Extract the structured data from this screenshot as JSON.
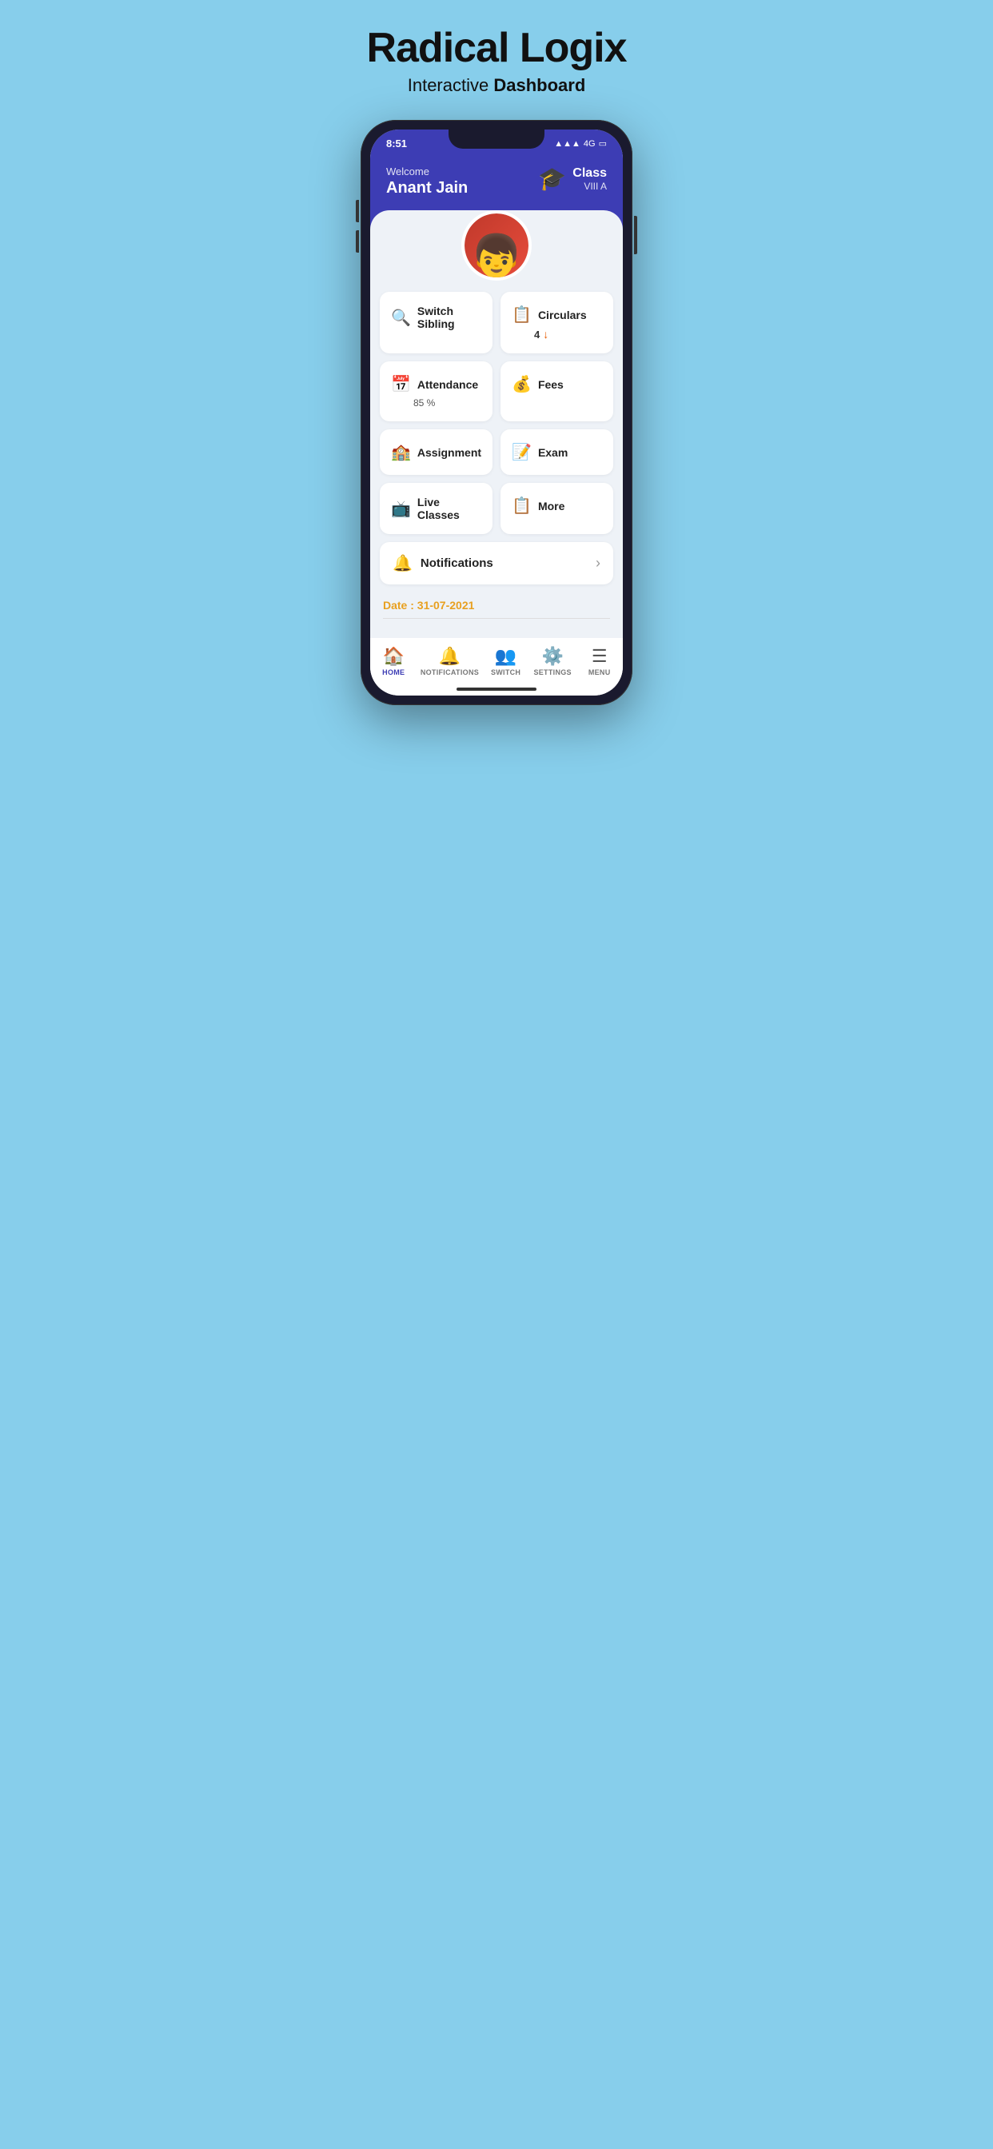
{
  "header": {
    "app_title": "Radical Logix",
    "app_subtitle_normal": "Interactive ",
    "app_subtitle_bold": "Dashboard"
  },
  "status_bar": {
    "time": "8:51",
    "signal": "4G",
    "battery": "🔋"
  },
  "welcome": {
    "label": "Welcome",
    "name": "Anant  Jain"
  },
  "class_info": {
    "label": "Class",
    "value": "VIII A"
  },
  "grid_items": [
    {
      "id": "switch-sibling",
      "icon": "🔍",
      "label": "Switch Sibling",
      "sub": null
    },
    {
      "id": "circulars",
      "icon": "📋",
      "label": "Circulars",
      "sub": "4",
      "has_arrow": true
    },
    {
      "id": "attendance",
      "icon": "📅",
      "label": "Attendance",
      "sub": "85 %"
    },
    {
      "id": "fees",
      "icon": "💰",
      "label": "Fees",
      "sub": null
    },
    {
      "id": "assignment",
      "icon": "🏫",
      "label": "Assignment",
      "sub": null
    },
    {
      "id": "exam",
      "icon": "📝",
      "label": "Exam",
      "sub": null
    },
    {
      "id": "live-classes",
      "icon": "📺",
      "label": "Live Classes",
      "sub": null
    },
    {
      "id": "more",
      "icon": "📋",
      "label": "More",
      "sub": null
    }
  ],
  "notifications": {
    "label": "Notifications",
    "icon": "🔔"
  },
  "date": {
    "text": "Date : 31-07-2021"
  },
  "bottom_nav": [
    {
      "id": "home",
      "icon": "🏠",
      "label": "HOME",
      "active": true
    },
    {
      "id": "notifications",
      "icon": "🔔",
      "label": "NOTIFICATIONS",
      "active": false
    },
    {
      "id": "switch",
      "icon": "👥",
      "label": "SWITCH",
      "active": false
    },
    {
      "id": "settings",
      "icon": "⚙️",
      "label": "SETTINGS",
      "active": false
    },
    {
      "id": "menu",
      "icon": "☰",
      "label": "MENU",
      "active": false
    }
  ],
  "colors": {
    "header_bg": "#3d3db4",
    "accent_orange": "#e8a020",
    "background": "#87CEEB"
  }
}
